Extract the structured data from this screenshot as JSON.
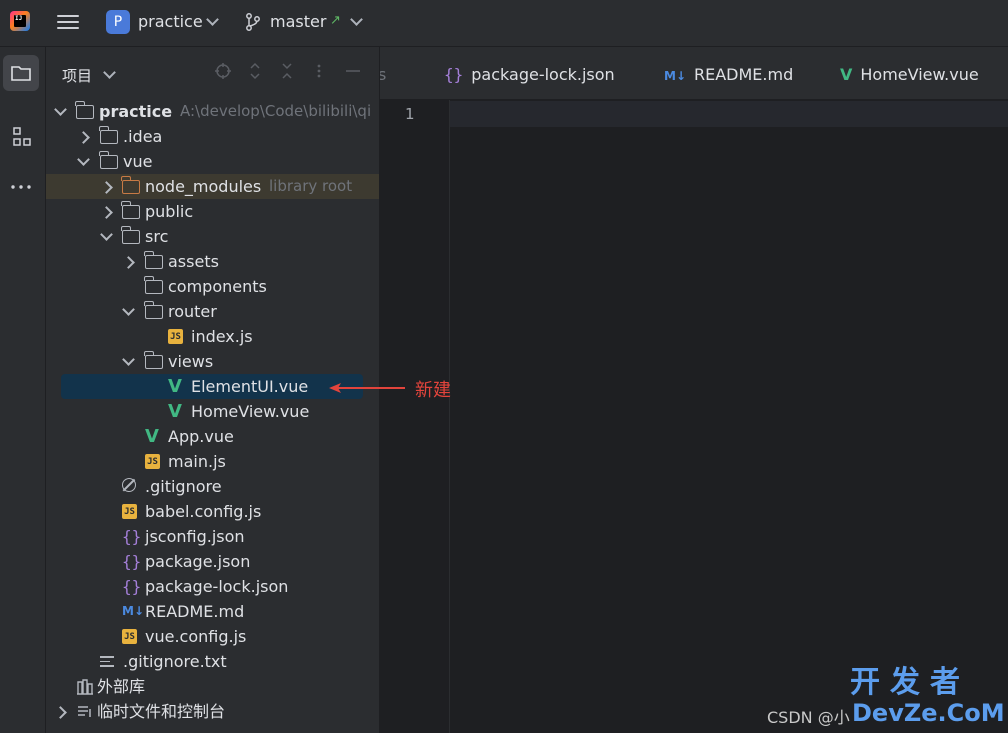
{
  "titlebar": {
    "project_badge": "P",
    "project_name": "practice",
    "branch": "master",
    "branch_arrow": "↗"
  },
  "panel": {
    "title": "项目",
    "tree": [
      {
        "label": "practice",
        "hint": "A:\\develop\\Code\\bilibili\\qi",
        "icon": "folder",
        "level": 0,
        "arrow": "down",
        "bold": true
      },
      {
        "label": ".idea",
        "icon": "folder",
        "level": 1,
        "arrow": "right"
      },
      {
        "label": "vue",
        "icon": "folder",
        "level": 1,
        "arrow": "down"
      },
      {
        "label": "node_modules",
        "hint": "library root",
        "icon": "folder-orange",
        "level": 2,
        "arrow": "right",
        "library": true
      },
      {
        "label": "public",
        "icon": "folder",
        "level": 2,
        "arrow": "right"
      },
      {
        "label": "src",
        "icon": "folder",
        "level": 2,
        "arrow": "down"
      },
      {
        "label": "assets",
        "icon": "folder",
        "level": 3,
        "arrow": "right"
      },
      {
        "label": "components",
        "icon": "folder",
        "level": 3,
        "arrow": "none"
      },
      {
        "label": "router",
        "icon": "folder",
        "level": 3,
        "arrow": "down"
      },
      {
        "label": "index.js",
        "icon": "js",
        "level": 4,
        "arrow": "none"
      },
      {
        "label": "views",
        "icon": "folder",
        "level": 3,
        "arrow": "down"
      },
      {
        "label": "ElementUI.vue",
        "icon": "vue",
        "level": 4,
        "arrow": "none",
        "selected": true
      },
      {
        "label": "HomeView.vue",
        "icon": "vue",
        "level": 4,
        "arrow": "none"
      },
      {
        "label": "App.vue",
        "icon": "vue",
        "level": 3,
        "arrow": "none"
      },
      {
        "label": "main.js",
        "icon": "js",
        "level": 3,
        "arrow": "none"
      },
      {
        "label": ".gitignore",
        "icon": "ignore",
        "level": 2,
        "arrow": "none"
      },
      {
        "label": "babel.config.js",
        "icon": "js",
        "level": 2,
        "arrow": "none"
      },
      {
        "label": "jsconfig.json",
        "icon": "json",
        "level": 2,
        "arrow": "none"
      },
      {
        "label": "package.json",
        "icon": "json",
        "level": 2,
        "arrow": "none"
      },
      {
        "label": "package-lock.json",
        "icon": "json",
        "level": 2,
        "arrow": "none"
      },
      {
        "label": "README.md",
        "icon": "md",
        "level": 2,
        "arrow": "none"
      },
      {
        "label": "vue.config.js",
        "icon": "js",
        "level": 2,
        "arrow": "none"
      },
      {
        "label": ".gitignore.txt",
        "icon": "txt",
        "level": 1,
        "arrow": "none"
      },
      {
        "label": "外部库",
        "icon": "library",
        "level": 0,
        "arrow": "none"
      },
      {
        "label": "临时文件和控制台",
        "icon": "scratch",
        "level": 0,
        "arrow": "right"
      }
    ]
  },
  "tabs": [
    {
      "label": "s",
      "icon": "none",
      "partial": true
    },
    {
      "label": "package-lock.json",
      "icon": "json"
    },
    {
      "label": "README.md",
      "icon": "md"
    },
    {
      "label": "HomeView.vue",
      "icon": "vue"
    }
  ],
  "icons": {
    "vue": "V",
    "js": "JS",
    "json": "{}",
    "md": "M↓"
  },
  "editor": {
    "line_number": "1"
  },
  "annotation": {
    "text": "新建",
    "color": "#e2443c"
  },
  "watermark": {
    "csdn": "CSDN @小",
    "brand_cn": "开发者",
    "brand_en": "DevZe.CoM"
  }
}
